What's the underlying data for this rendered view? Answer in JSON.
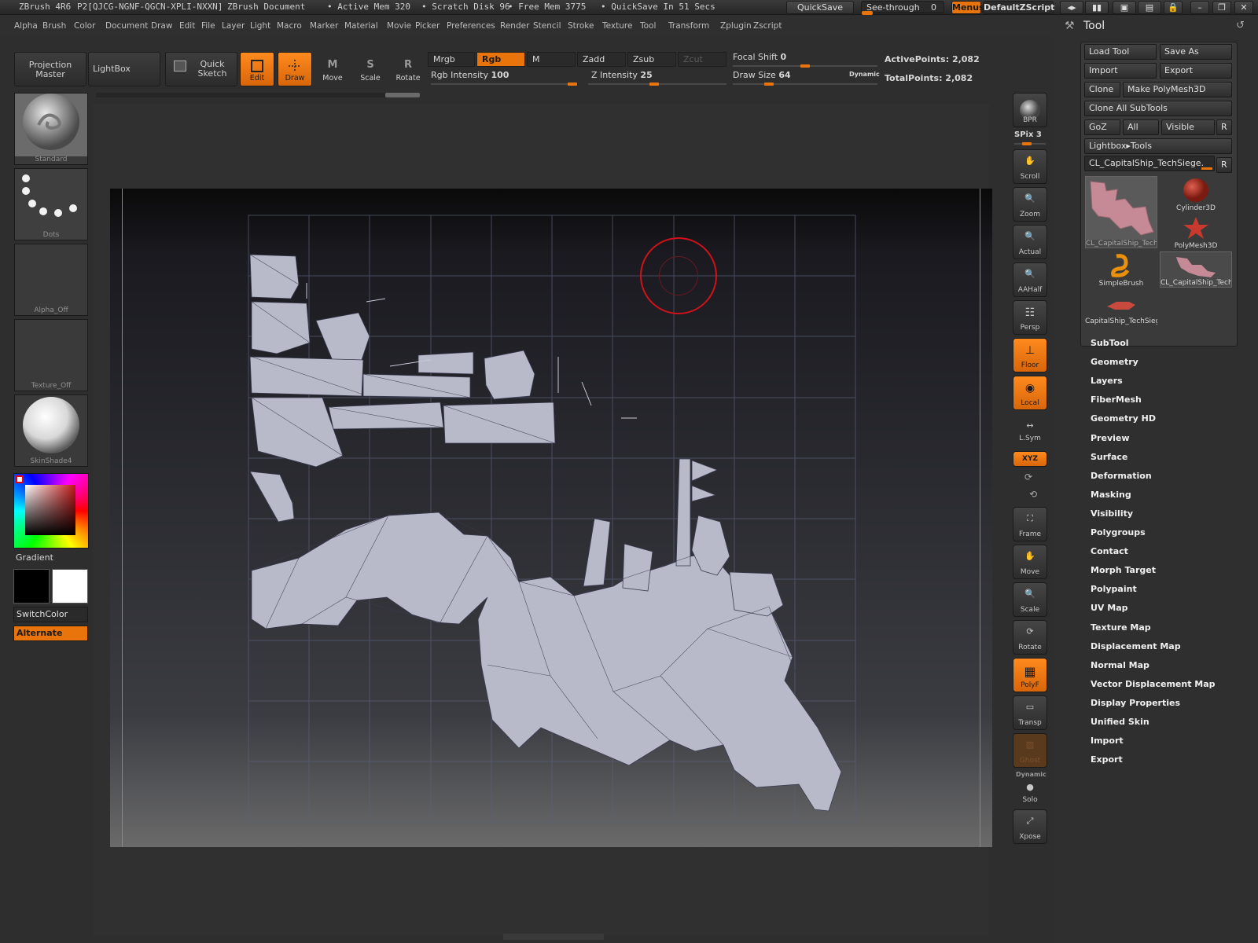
{
  "titlebar": {
    "app": "ZBrush 4R6",
    "serial": "P2[QJCG-NGNF-QGCN-XPLI-NXXN]",
    "document": "ZBrush Document",
    "active_mem": "• Active Mem 320",
    "scratch_disk": "• Scratch Disk 96",
    "free_mem": "• Free Mem 3775",
    "quicksave_timer": "• QuickSave In 51 Secs",
    "quicksave_label": "QuickSave",
    "see_through_label": "See-through",
    "see_through_value": "0",
    "menus_label": "Menus",
    "zscript_label": "DefaultZScript"
  },
  "menubar": [
    "Alpha",
    "Brush",
    "Color",
    "Document",
    "Draw",
    "Edit",
    "File",
    "Layer",
    "Light",
    "Macro",
    "Marker",
    "Material",
    "Movie",
    "Picker",
    "Preferences",
    "Render",
    "Stencil",
    "Stroke",
    "Texture",
    "Tool",
    "Transform",
    "Zplugin",
    "Zscript"
  ],
  "shelf": {
    "projection_master": "Projection Master",
    "lightbox": "LightBox",
    "quick_sketch": "Quick Sketch",
    "edit": "Edit",
    "draw": "Draw",
    "move": "Move",
    "scale": "Scale",
    "rotate": "Rotate",
    "mrgb": "Mrgb",
    "rgb": "Rgb",
    "m": "M",
    "zadd": "Zadd",
    "zsub": "Zsub",
    "zcut": "Zcut",
    "rgb_intensity_label": "Rgb Intensity",
    "rgb_intensity_value": "100",
    "z_intensity_label": "Z Intensity",
    "z_intensity_value": "25",
    "focal_shift_label": "Focal Shift",
    "focal_shift_value": "0",
    "draw_size_label": "Draw Size",
    "draw_size_value": "64",
    "dynamic_label": "Dynamic",
    "active_points": "ActivePoints: 2,082",
    "total_points": "TotalPoints: 2,082"
  },
  "left": {
    "brush": "Standard",
    "stroke": "Dots",
    "alpha": "Alpha_Off",
    "texture": "Texture_Off",
    "material": "SkinShade4",
    "gradient": "Gradient",
    "switch_color": "SwitchColor",
    "alternate": "Alternate",
    "main_color": "#000000",
    "secondary_color": "#ffffff"
  },
  "right_shelf": {
    "bpr": "BPR",
    "spix": "SPix 3",
    "scroll": "Scroll",
    "zoom": "Zoom",
    "actual": "Actual",
    "aahalf": "AAHalf",
    "persp": "Persp",
    "floor": "Floor",
    "local": "Local",
    "lsym": "L.Sym",
    "xyz": "XYZ",
    "frame": "Frame",
    "move": "Move",
    "scale": "Scale",
    "rotate": "Rotate",
    "polyf": "PolyF",
    "transp": "Transp",
    "ghost": "Ghost",
    "dynamic": "Dynamic",
    "solo": "Solo",
    "xpose": "Xpose"
  },
  "tool_panel": {
    "title": "Tool",
    "load_tool": "Load Tool",
    "save_as": "Save As",
    "import": "Import",
    "export": "Export",
    "clone": "Clone",
    "make_polymesh": "Make PolyMesh3D",
    "clone_all": "Clone All SubTools",
    "goz": "GoZ",
    "all": "All",
    "visible": "Visible",
    "r": "R",
    "lightbox_tools": "Lightbox▸Tools",
    "current_tool": "CL_CapitalShip_TechSiege.",
    "tools": [
      {
        "name": "CL_CapitalShip_Tech",
        "icon": "uv-map-thumbnail"
      },
      {
        "name": "Cylinder3D",
        "icon": "cylinder-icon"
      },
      {
        "name": "PolyMesh3D",
        "icon": "star-icon"
      },
      {
        "name": "SimpleBrush",
        "icon": "simplebrush-icon"
      },
      {
        "name": "CL_CapitalShip_Tech",
        "icon": "uv-map-thumbnail"
      },
      {
        "name": "CapitalShip_TechSieg",
        "icon": "ship-icon"
      }
    ],
    "submenus": [
      "SubTool",
      "Geometry",
      "Layers",
      "FiberMesh",
      "Geometry HD",
      "Preview",
      "Surface",
      "Deformation",
      "Masking",
      "Visibility",
      "Polygroups",
      "Contact",
      "Morph Target",
      "Polypaint",
      "UV Map",
      "Texture Map",
      "Displacement Map",
      "Normal Map",
      "Vector Displacement Map",
      "Display Properties",
      "Unified Skin",
      "Import",
      "Export"
    ]
  },
  "colors": {
    "accent": "#e9740c",
    "panel": "#2f2f2f",
    "mesh_fill": "#b8b9c9",
    "mesh_line": "#3a3b50",
    "cursor": "#d0121a"
  }
}
